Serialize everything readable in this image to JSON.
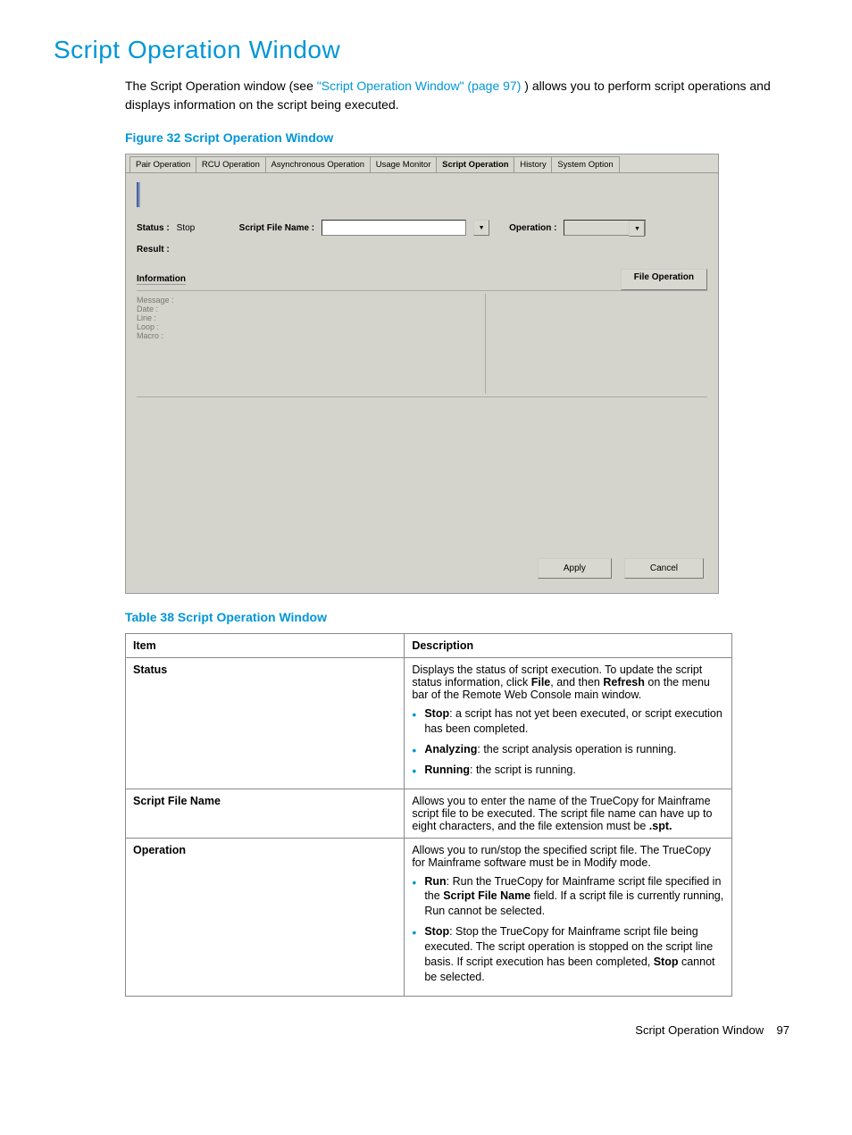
{
  "heading": "Script Operation Window",
  "intro_pre": "The Script Operation window (see ",
  "intro_link": "\"Script Operation Window\" (page 97)",
  "intro_post": ") allows you to perform script operations and displays information on the script being executed.",
  "figure_caption": "Figure 32 Script Operation Window",
  "tabs": {
    "t1": "Pair Operation",
    "t2": "RCU Operation",
    "t3": "Asynchronous Operation",
    "t4": "Usage Monitor",
    "t5": "Script Operation",
    "t6": "History",
    "t7": "System Option"
  },
  "shot": {
    "status_label": "Status :",
    "status_value": "Stop",
    "sfn_label": "Script File Name :",
    "op_label": "Operation :",
    "result_label": "Result :",
    "info_label": "Information",
    "file_op_btn": "File Operation",
    "info_lines": {
      "l1": "Message :",
      "l2": "Date :",
      "l3": "Line  :",
      "l4": "Loop :",
      "l5": "Macro :"
    },
    "apply": "Apply",
    "cancel": "Cancel"
  },
  "table_caption": "Table 38 Script Operation Window",
  "table": {
    "h1": "Item",
    "h2": "Description",
    "r1_item": "Status",
    "r1_desc": "Displays the status of script execution. To update the script status information, click ",
    "r1_desc_b1": "File",
    "r1_desc_mid": ", and then ",
    "r1_desc_b2": "Refresh",
    "r1_desc_end": " on the menu bar of the Remote Web Console main window.",
    "r1_b1_b": "Stop",
    "r1_b1_t": ": a script has not yet been executed, or script execution has been completed.",
    "r1_b2_b": "Analyzing",
    "r1_b2_t": ": the script analysis operation is running.",
    "r1_b3_b": "Running",
    "r1_b3_t": ": the script is running.",
    "r2_item": "Script File Name",
    "r2_desc_pre": "Allows you to enter the name of the TrueCopy for Mainframe script file to be executed. The script file name can have up to eight characters, and the file extension must be ",
    "r2_desc_ext": ".spt.",
    "r3_item": "Operation",
    "r3_desc": "Allows you to run/stop the specified script file. The TrueCopy for Mainframe software must be in Modify mode.",
    "r3_b1_b": "Run",
    "r3_b1_t1": ": Run the TrueCopy for Mainframe script file specified in the ",
    "r3_b1_bf": "Script File Name",
    "r3_b1_t2": " field. If a script file is currently running, Run cannot be selected.",
    "r3_b2_b": "Stop",
    "r3_b2_t1": ": Stop the TrueCopy for Mainframe script file being executed. The script operation is stopped on the script line basis. If script execution has been completed, ",
    "r3_b2_bf": "Stop",
    "r3_b2_t2": " cannot be selected."
  },
  "footer_text": "Script Operation Window",
  "footer_page": "97"
}
